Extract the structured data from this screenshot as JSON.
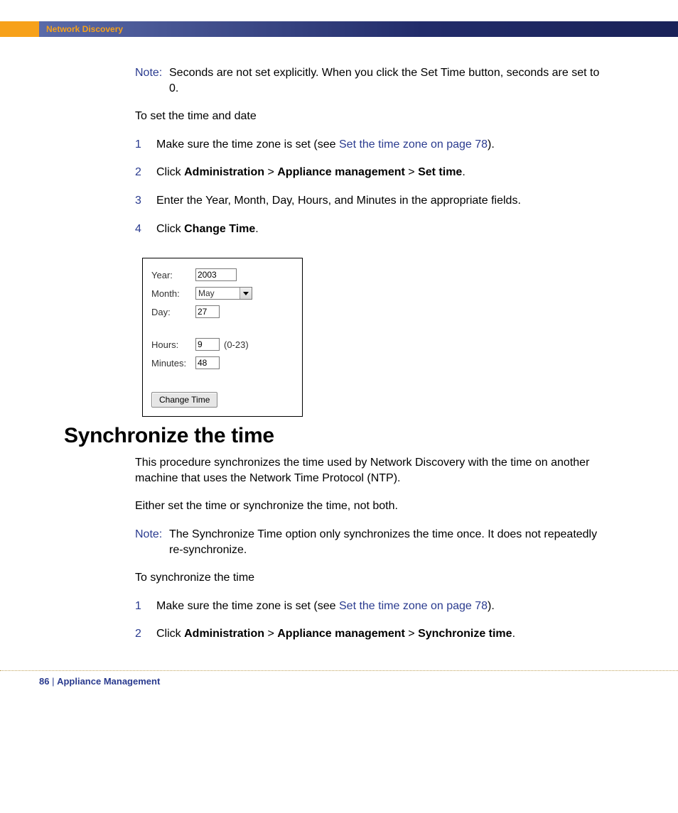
{
  "header": {
    "title": "Network Discovery"
  },
  "notes": {
    "label": "Note:",
    "set_time": "Seconds are not set explicitly. When you click the Set Time button, seconds are set to 0.",
    "sync_time": "The Synchronize Time option only synchronizes the time once. It does not repeatedly re-synchronize."
  },
  "intro": {
    "to_set": "To set the time and date",
    "to_sync": "To synchronize the time"
  },
  "steps_set_time": [
    {
      "n": "1",
      "pre": "Make sure the time zone is set (see ",
      "xref": "Set the time zone on page 78",
      "post": ")."
    },
    {
      "n": "2",
      "t1": "Click ",
      "b1": "Administration",
      "gt1": " > ",
      "b2": "Appliance management",
      "gt2": " > ",
      "b3": "Set time",
      "end": "."
    },
    {
      "n": "3",
      "text": "Enter the Year, Month, Day, Hours, and Minutes in the appropriate fields."
    },
    {
      "n": "4",
      "t1": "Click ",
      "b1": "Change Time",
      "end": "."
    }
  ],
  "dialog": {
    "year_label": "Year:",
    "year_value": "2003",
    "month_label": "Month:",
    "month_value": "May",
    "day_label": "Day:",
    "day_value": "27",
    "hours_label": "Hours:",
    "hours_value": "9",
    "hours_suffix": "(0-23)",
    "minutes_label": "Minutes:",
    "minutes_value": "48",
    "button": "Change Time"
  },
  "section": {
    "sync_heading": "Synchronize the time",
    "sync_p1": "This procedure synchronizes the time used by Network Discovery with the time on another machine that uses the Network Time Protocol (NTP).",
    "sync_p2": "Either set the time or synchronize the time, not both."
  },
  "steps_sync": [
    {
      "n": "1",
      "pre": "Make sure the time zone is set (see ",
      "xref": "Set the time zone on page 78",
      "post": ")."
    },
    {
      "n": "2",
      "t1": "Click ",
      "b1": "Administration",
      "gt1": " > ",
      "b2": "Appliance management",
      "gt2": " > ",
      "b3": "Synchronize time",
      "end": "."
    }
  ],
  "footer": {
    "page": "86",
    "sep": " | ",
    "chapter": "Appliance Management"
  }
}
